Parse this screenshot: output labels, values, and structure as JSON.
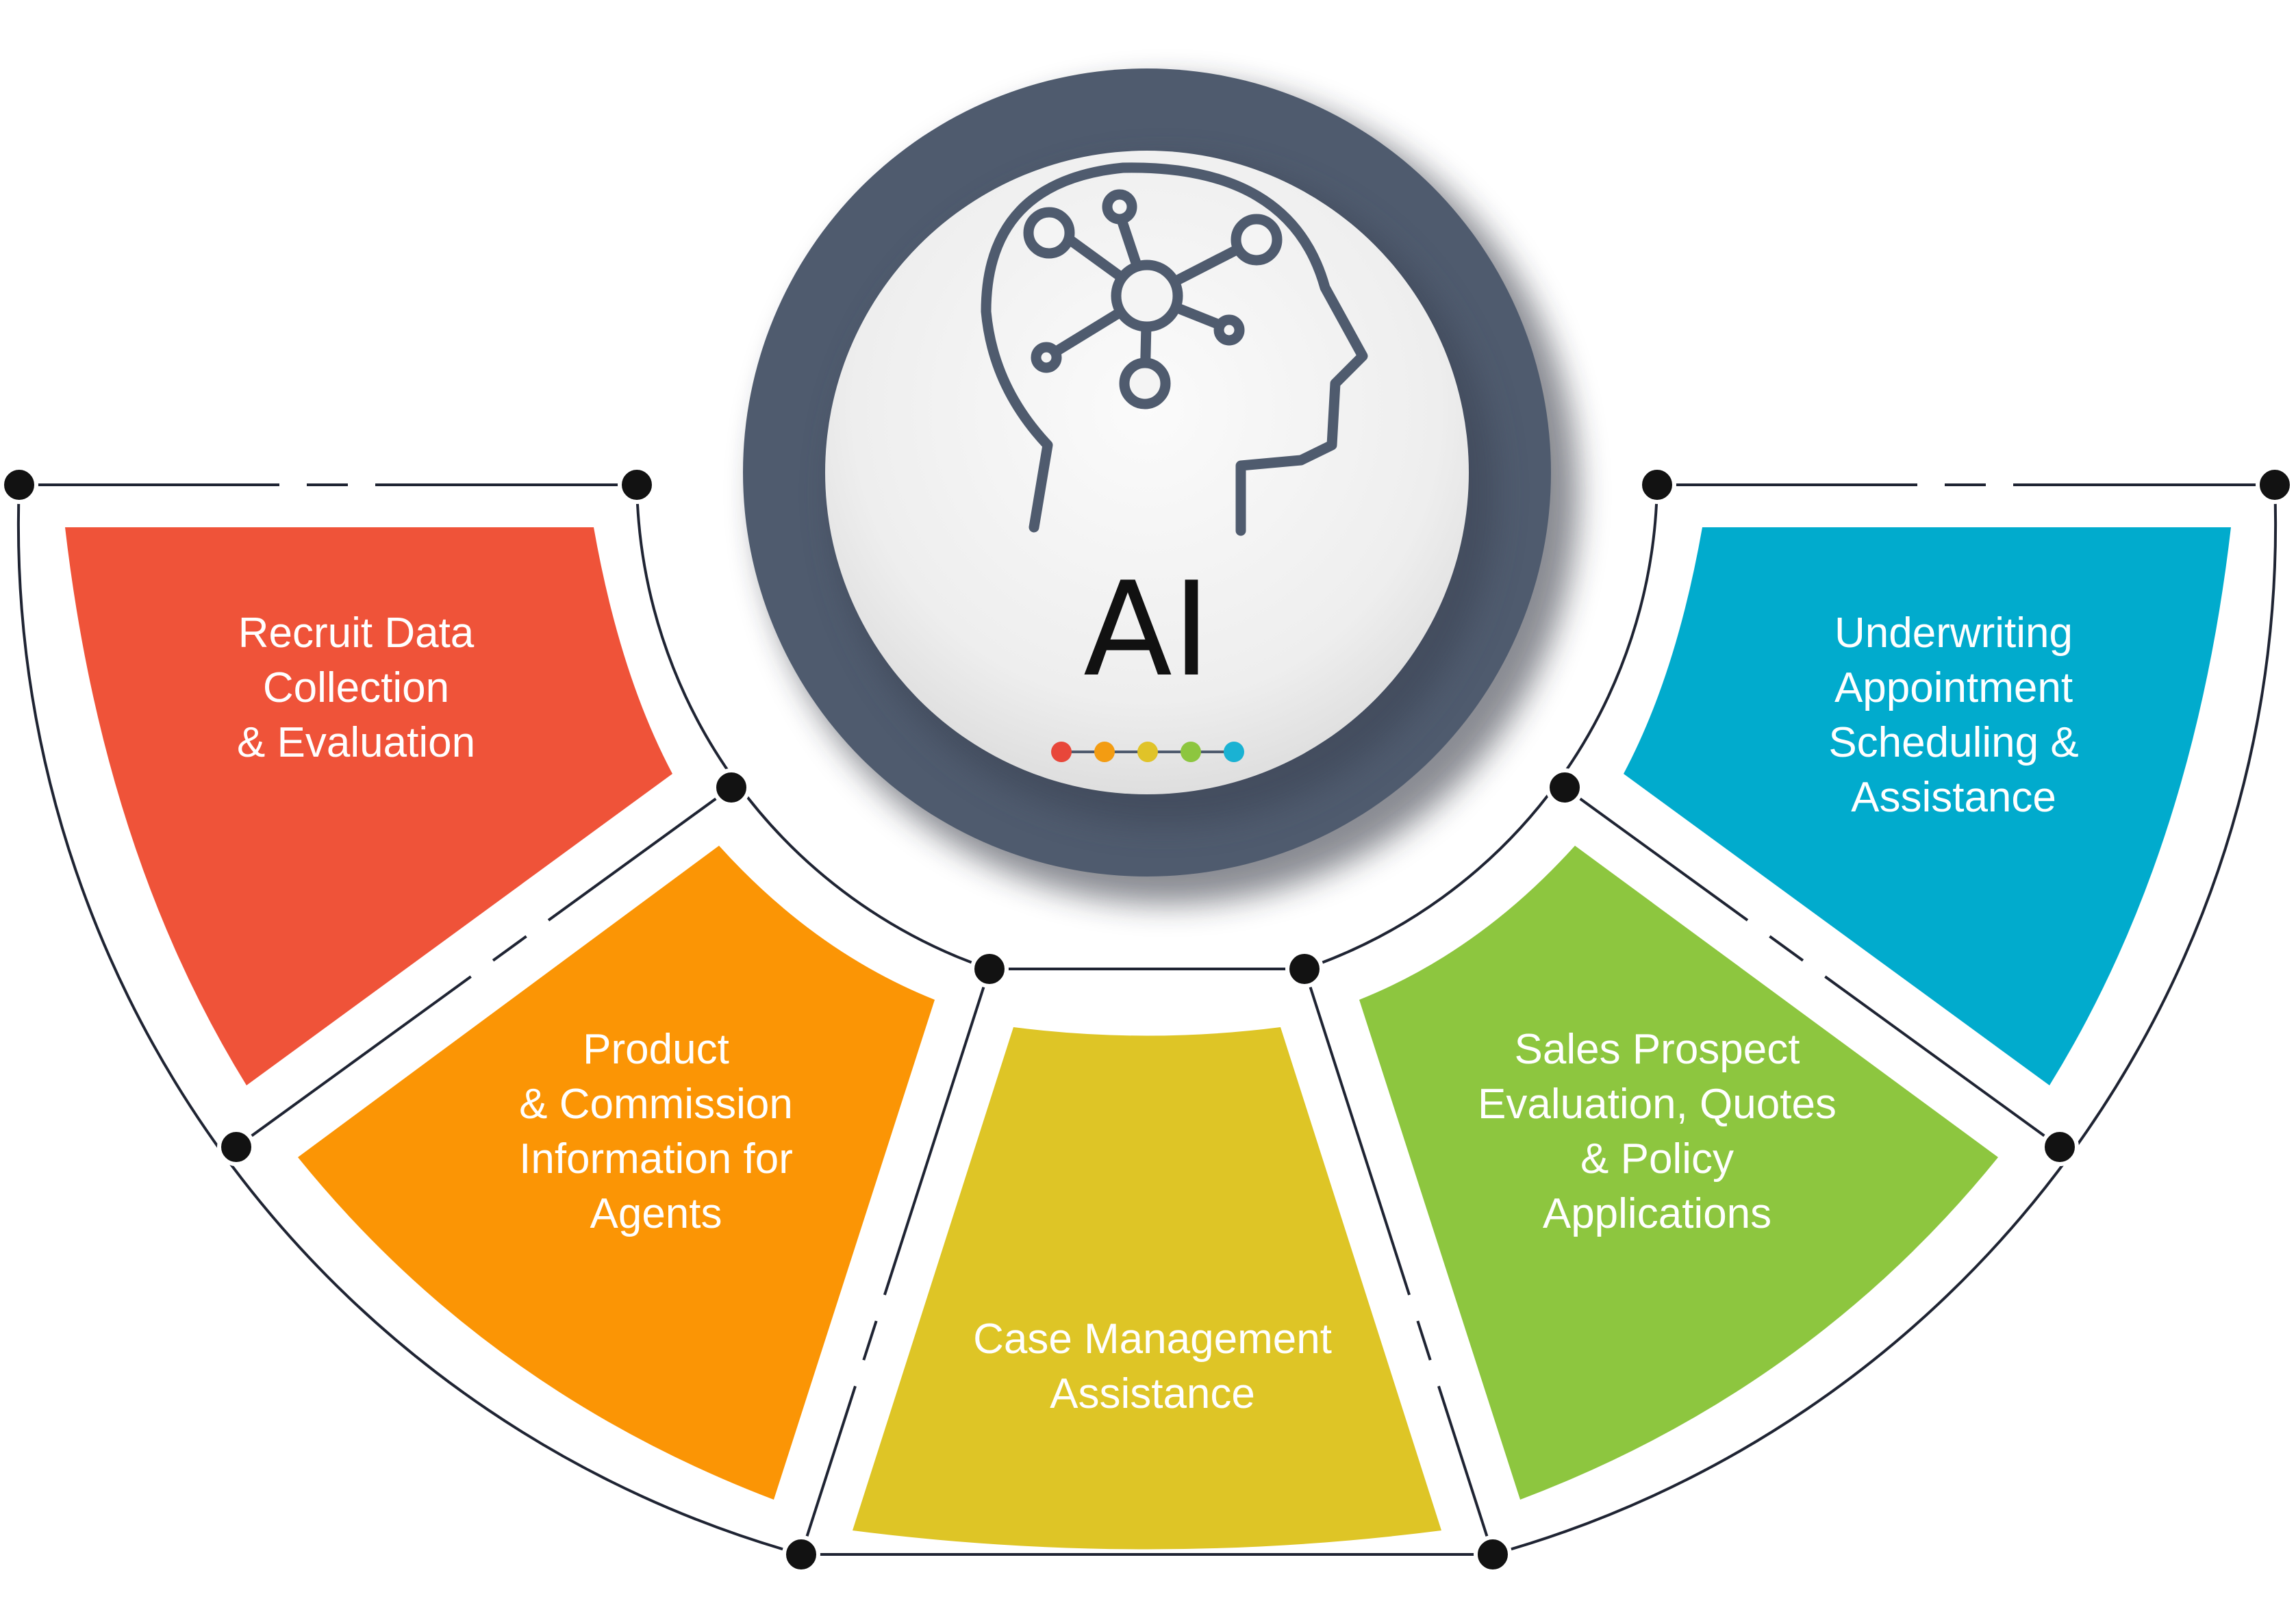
{
  "center": {
    "title": "AI",
    "icon": "brain-network-head-icon",
    "ring_color": "#4f5b6e",
    "dot_colors": [
      "#e8473a",
      "#f39c12",
      "#e0c328",
      "#8dc63f",
      "#1ab2d3"
    ]
  },
  "segments": [
    {
      "id": "recruit",
      "lines": [
        "Recruit Data",
        "Collection",
        "& Evaluation"
      ],
      "color": "#ef5339"
    },
    {
      "id": "product",
      "lines": [
        "Product",
        "& Commission",
        "Information for",
        "Agents"
      ],
      "color": "#fb9505"
    },
    {
      "id": "case",
      "lines": [
        "Case Management",
        "Assistance"
      ],
      "color": "#dec526"
    },
    {
      "id": "sales",
      "lines": [
        "Sales Prospect",
        "Evaluation, Quotes",
        "& Policy",
        "Applications"
      ],
      "color": "#8dc63f"
    },
    {
      "id": "underwriting",
      "lines": [
        "Underwriting",
        "Appointment",
        "Scheduling &",
        "Assistance"
      ],
      "color": "#01abcd"
    }
  ]
}
